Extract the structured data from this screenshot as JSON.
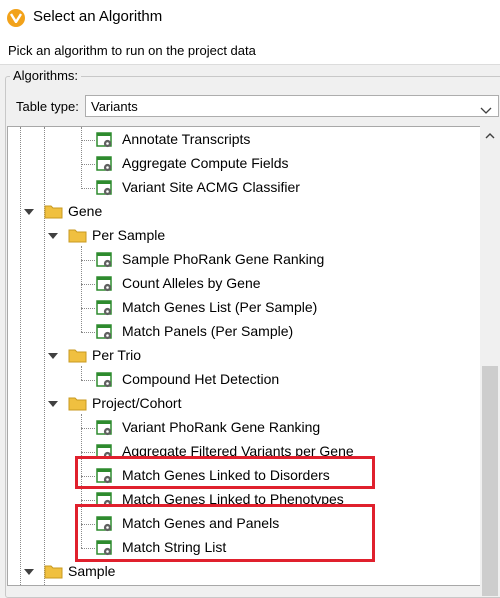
{
  "window": {
    "title": "Select an Algorithm"
  },
  "instruction": "Pick an algorithm to run on the project data",
  "algorithms_group": {
    "label": "Algorithms:"
  },
  "table_type": {
    "label": "Table type:",
    "value": "Variants"
  },
  "tree": {
    "items": [
      {
        "label": "Annotate Transcripts"
      },
      {
        "label": "Aggregate Compute Fields"
      },
      {
        "label": "Variant Site ACMG Classifier"
      },
      {
        "label": "Gene"
      },
      {
        "label": "Per Sample"
      },
      {
        "label": "Sample PhoRank Gene Ranking"
      },
      {
        "label": "Count Alleles by Gene"
      },
      {
        "label": "Match Genes List (Per Sample)"
      },
      {
        "label": "Match Panels (Per Sample)"
      },
      {
        "label": "Per Trio"
      },
      {
        "label": "Compound Het Detection"
      },
      {
        "label": "Project/Cohort"
      },
      {
        "label": "Variant PhoRank Gene Ranking"
      },
      {
        "label": "Aggregate Filtered Variants per Gene"
      },
      {
        "label": "Match Genes Linked to Disorders"
      },
      {
        "label": "Match Genes Linked to Phenotypes"
      },
      {
        "label": "Match Genes and Panels"
      },
      {
        "label": "Match String List"
      },
      {
        "label": "Sample"
      }
    ]
  },
  "colors": {
    "highlight": "#e0202d",
    "folder": "#f0c040",
    "algo_icon": "#2e8b2e"
  }
}
